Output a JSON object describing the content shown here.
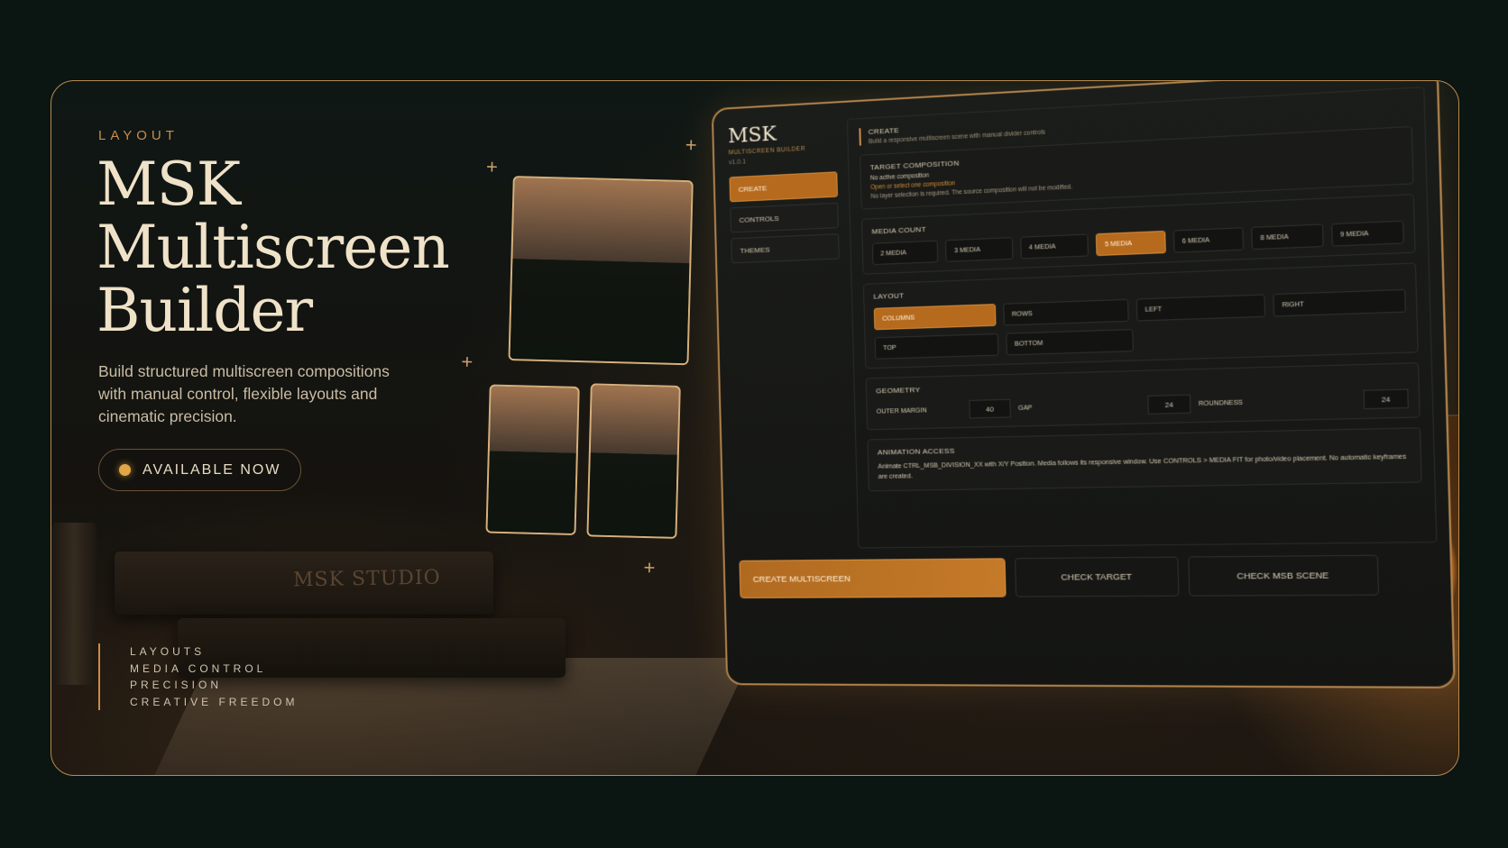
{
  "hero": {
    "eyebrow": "LAYOUT",
    "title_lines": [
      "MSK",
      "Multiscreen",
      "Builder"
    ],
    "description": "Build structured multiscreen compositions with manual control, flexible layouts and cinematic precision.",
    "cta_label": "AVAILABLE NOW",
    "tags": [
      "LAYOUTS",
      "MEDIA CONTROL",
      "PRECISION",
      "CREATIVE FREEDOM"
    ],
    "book_label": "MSK STUDIO"
  },
  "panel": {
    "logo": "MSK",
    "logo_sub": "MULTISCREEN BUILDER",
    "version": "v1.0.1",
    "nav": [
      "CREATE",
      "CONTROLS",
      "THEMES"
    ],
    "nav_active": "CREATE",
    "create": {
      "title": "CREATE",
      "subtitle": "Build a responsive multiscreen scene with manual divider controls"
    },
    "target": {
      "title": "TARGET COMPOSITION",
      "status": "No active composition",
      "warning": "Open or select one composition",
      "note": "No layer selection is required. The source composition will not be modified."
    },
    "media_count": {
      "title": "MEDIA COUNT",
      "options": [
        "2 MEDIA",
        "3 MEDIA",
        "4 MEDIA",
        "5 MEDIA",
        "6 MEDIA",
        "8 MEDIA",
        "9 MEDIA"
      ],
      "selected": "5 MEDIA"
    },
    "layout": {
      "title": "LAYOUT",
      "row1": [
        "COLUMNS",
        "ROWS",
        "LEFT",
        "RIGHT"
      ],
      "row2": [
        "TOP",
        "BOTTOM"
      ],
      "selected": "COLUMNS"
    },
    "geometry": {
      "title": "GEOMETRY",
      "outer_margin_label": "OUTER MARGIN",
      "outer_margin": "40",
      "gap_label": "GAP",
      "gap": "24",
      "roundness_label": "ROUNDNESS",
      "roundness": "24"
    },
    "animation": {
      "title": "ANIMATION ACCESS",
      "text": "Animate CTRL_MSB_DIVISION_XX with X/Y Position. Media follows its responsive window. Use CONTROLS > MEDIA FIT for photo/video placement. No automatic keyframes are created."
    },
    "actions": {
      "create": "CREATE MULTISCREEN",
      "check_target": "CHECK TARGET",
      "check_scene": "CHECK MSB SCENE"
    }
  },
  "colors": {
    "accent": "#c98b4c",
    "active": "#b66a1d",
    "background": "#0b1512"
  }
}
